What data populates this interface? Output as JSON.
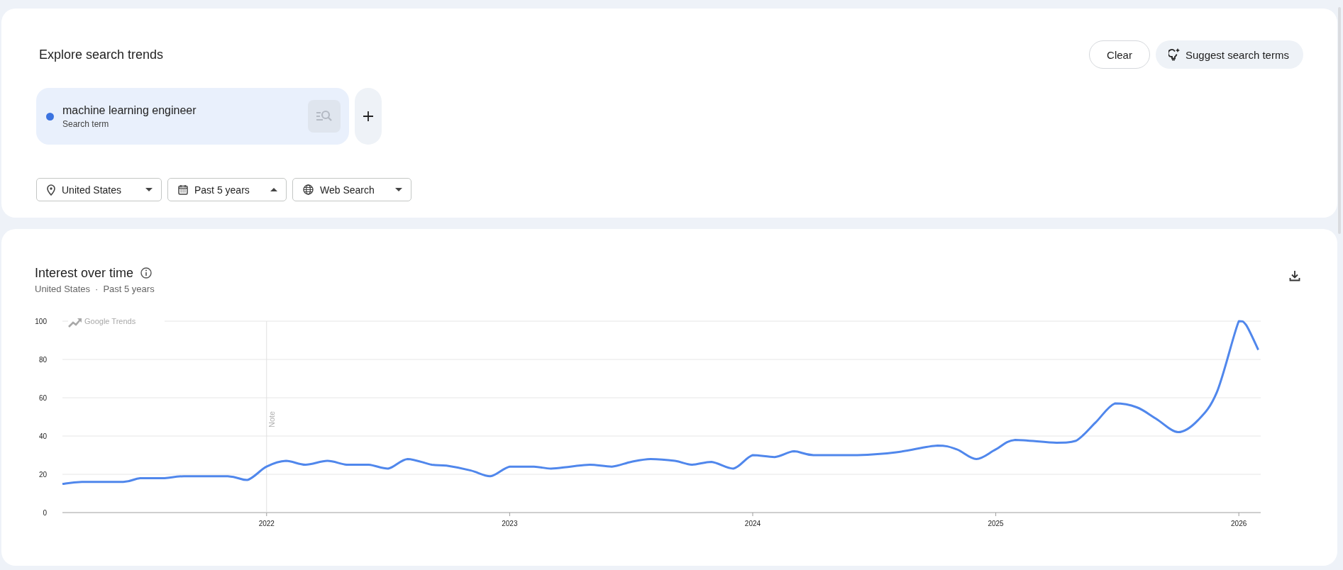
{
  "explore": {
    "title": "Explore search trends",
    "buttons": [
      {
        "kind": "outline",
        "label": "Clear"
      },
      {
        "kind": "suggest",
        "label": "Suggest search terms"
      }
    ],
    "terms": [
      {
        "term": "machine learning engineer",
        "subtitle": "Search term",
        "color": "#3b73e0"
      }
    ],
    "filters": [
      {
        "kind": "location",
        "label": "United States",
        "expanded": false
      },
      {
        "kind": "time",
        "label": "Past 5 years",
        "expanded": true
      },
      {
        "kind": "property",
        "label": "Web Search",
        "expanded": false
      }
    ]
  },
  "interest": {
    "title": "Interest over time",
    "subtitle": [
      "United States",
      "·",
      "Past 5 years"
    ],
    "branding": "Google Trends",
    "chart_data": {
      "type": "line",
      "grid": true,
      "ref_lines": [
        {
          "axis": "x",
          "value": 2022
        }
      ],
      "annotations": [
        {
          "x": 2022,
          "text": "Note"
        }
      ],
      "xlim": [
        2021.16,
        2026.09
      ],
      "ylim": [
        0,
        100
      ],
      "yticks": [
        0,
        20,
        40,
        60,
        80,
        100
      ],
      "xticks": [
        {
          "value": 2022,
          "label": "2022"
        },
        {
          "value": 2023,
          "label": "2023"
        },
        {
          "value": 2024,
          "label": "2024"
        },
        {
          "value": 2025,
          "label": "2025"
        },
        {
          "value": 2026,
          "label": "2026"
        }
      ],
      "x": [
        2021.16,
        2021.24,
        2021.41,
        2021.48,
        2021.58,
        2021.66,
        2021.84,
        2021.92,
        2022.0,
        2022.08,
        2022.16,
        2022.25,
        2022.33,
        2022.42,
        2022.5,
        2022.58,
        2022.68,
        2022.74,
        2022.84,
        2022.92,
        2023.0,
        2023.1,
        2023.17,
        2023.25,
        2023.33,
        2023.42,
        2023.5,
        2023.58,
        2023.68,
        2023.75,
        2023.83,
        2023.92,
        2024.0,
        2024.09,
        2024.17,
        2024.25,
        2024.43,
        2024.59,
        2024.76,
        2024.84,
        2024.92,
        2025.0,
        2025.08,
        2025.25,
        2025.33,
        2025.41,
        2025.49,
        2025.58,
        2025.66,
        2025.75,
        2025.83,
        2025.91,
        2026.0,
        2026.03,
        2026.08
      ],
      "series": [
        {
          "color": "#5087ec",
          "values": [
            15,
            16,
            16,
            18,
            18,
            19,
            19,
            17,
            24,
            27,
            25,
            27,
            25,
            25,
            23,
            28,
            25,
            24.5,
            22,
            19,
            24,
            24,
            23,
            24,
            25,
            24,
            26.5,
            28,
            27,
            25,
            26.5,
            23,
            30,
            29,
            32,
            30,
            30,
            31.5,
            35,
            33,
            28,
            33,
            38,
            36.5,
            37.5,
            47,
            57,
            55,
            49,
            42,
            48,
            63,
            100,
            98,
            85
          ]
        }
      ]
    }
  }
}
